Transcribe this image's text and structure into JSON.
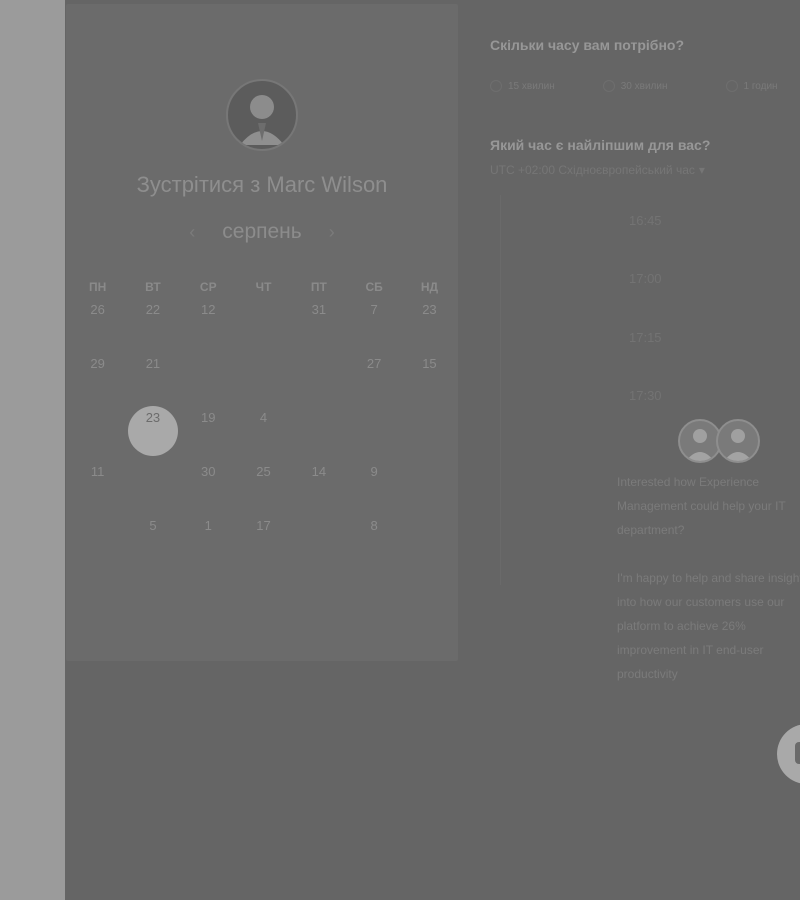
{
  "host": {
    "title": "Зустрітися з Marc Wilson",
    "month": "серпень",
    "prev_icon": "chevron-left-icon",
    "next_icon": "chevron-right-icon"
  },
  "calendar": {
    "dow": [
      "ПН",
      "ВТ",
      "СР",
      "ЧТ",
      "ПТ",
      "СБ",
      "НД"
    ],
    "weeks": [
      [
        "26",
        "22",
        "12",
        "",
        "31",
        "7",
        "23"
      ],
      [
        "29",
        "21",
        "",
        "",
        "",
        "27",
        "15"
      ],
      [
        "",
        "23",
        "19",
        "4",
        "",
        "",
        ""
      ],
      [
        "11",
        "",
        "30",
        "25",
        "14",
        "9",
        ""
      ],
      [
        "",
        "5",
        "1",
        "17",
        "",
        "8",
        ""
      ]
    ],
    "selected": "23"
  },
  "duration": {
    "question": "Скільки часу вам потрібно?",
    "options": [
      "15 хвилин",
      "30 хвилин",
      "1 годин"
    ]
  },
  "time": {
    "question": "Який час є найліпшим для вас?",
    "timezone": "UTC +02:00 Східноєвропейський час",
    "slots": [
      "16:45",
      "17:00",
      "17:15",
      "17:30"
    ]
  },
  "promo": {
    "p1": "Interested how Experience Management could help your IT department?",
    "p2": "I'm happy to help and share insight into how our customers use our platform to achieve 26% improvement in IT end-user productivity"
  },
  "colors": {
    "overlay": "#636363",
    "selected_day": "#a9a9a9"
  }
}
